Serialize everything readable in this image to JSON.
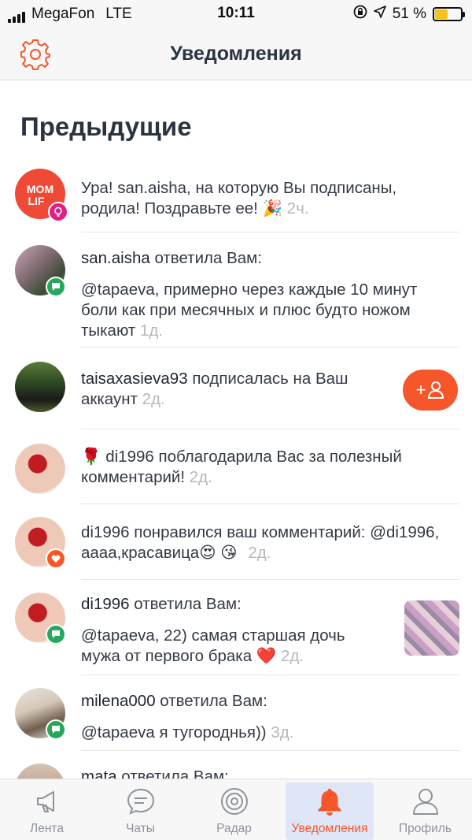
{
  "status_bar": {
    "carrier": "MegaFon",
    "network": "LTE",
    "time": "10:11",
    "battery": "51 %",
    "battery_level": 0.51
  },
  "header": {
    "title": "Уведомления",
    "settings_icon": "gear-icon"
  },
  "section_title": "Предыдущие",
  "notifications": [
    {
      "text": "Ура! san.aisha, на которую Вы подписаны, родила! Поздравьте ее!",
      "emoji": "🎉",
      "time": "2ч.",
      "avatar_text": "MOM LIF",
      "badge": "bulb-icon"
    },
    {
      "user": "san.aisha",
      "action": " ответила Вам:",
      "reply": "@tapaeva, примерно через каждые 10 минут боли как при месячных и плюс будто ножом тыкают",
      "time": "1д.",
      "badge": "chat-icon"
    },
    {
      "user": "taisaxasieva93",
      "action": " подписалась на Ваш аккаунт",
      "time": "2д.",
      "follow_label": "+",
      "follow_icon": "user-icon"
    },
    {
      "emoji_prefix": "🌹",
      "text": " di1996 поблагодарила Вас за полезный комментарий!",
      "time": "2д."
    },
    {
      "text": "di1996 понравился ваш комментарий: @di1996, аааа,красавица",
      "emoji": "😍 😘",
      "time": "2д.",
      "badge": "heart-icon"
    },
    {
      "user": "di1996",
      "action": " ответила Вам:",
      "reply": "@tapaeva, 22) самая старшая дочь мужа от первого брака",
      "emoji": "❤️",
      "time": "2д.",
      "badge": "chat-icon"
    },
    {
      "user": "milena000",
      "action": " ответила Вам:",
      "reply": "@tapaeva я тугороднья))",
      "time": "3д.",
      "badge": "chat-icon"
    },
    {
      "user": "mata",
      "action": " ответила Вам:"
    }
  ],
  "tabs": [
    {
      "label": "Лента",
      "icon": "megaphone-icon"
    },
    {
      "label": "Чаты",
      "icon": "chat-bubble-icon"
    },
    {
      "label": "Радар",
      "icon": "radar-icon"
    },
    {
      "label": "Уведомления",
      "icon": "bell-icon",
      "active": true
    },
    {
      "label": "Профиль",
      "icon": "profile-icon"
    }
  ],
  "colors": {
    "accent": "#f5562a",
    "badge_green": "#25a85b",
    "badge_heart": "#f5562a",
    "badge_pink": "#e01f85",
    "text": "#333a44",
    "muted": "#b4b8bd"
  }
}
